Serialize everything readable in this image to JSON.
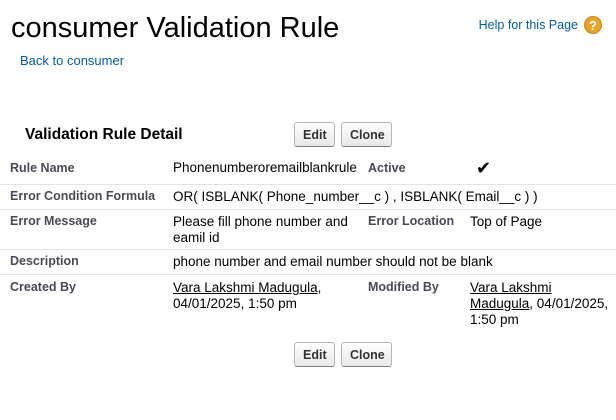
{
  "header": {
    "title": "consumer Validation Rule",
    "back_link": "Back to consumer",
    "help_text": "Help for this Page",
    "help_icon": "?"
  },
  "section": {
    "title": "Validation Rule Detail",
    "edit_label": "Edit",
    "clone_label": "Clone"
  },
  "fields": {
    "rule_name_label": "Rule Name",
    "rule_name_value": "Phonenumberoremailblankrule",
    "active_label": "Active",
    "active_checked": true,
    "active_mark": "✔",
    "formula_label": "Error Condition Formula",
    "formula_value": "OR( ISBLANK( Phone_number__c ) , ISBLANK( Email__c ) )",
    "error_message_label": "Error Message",
    "error_message_value": "Please fill phone number and eamil id",
    "error_location_label": "Error Location",
    "error_location_value": "Top of Page",
    "description_label": "Description",
    "description_value": "phone number and email number should not be blank",
    "created_by_label": "Created By",
    "created_by_user": "Vara Lakshmi Madugula",
    "created_by_date": ", 04/01/2025, 1:50 pm",
    "modified_by_label": "Modified By",
    "modified_by_user": "Vara Lakshmi Madugula",
    "modified_by_date": ", 04/01/2025, 1:50 pm"
  },
  "footer": {
    "edit_label": "Edit",
    "clone_label": "Clone"
  }
}
